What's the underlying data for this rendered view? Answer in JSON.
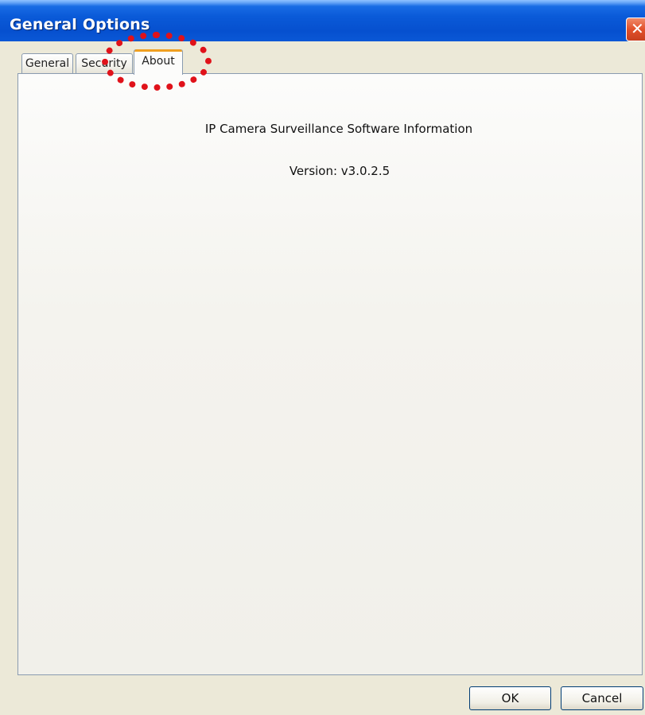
{
  "window": {
    "title": "General Options",
    "close_icon": "close-icon",
    "close_glyph": "✕"
  },
  "tabs": [
    {
      "label": "General",
      "selected": false
    },
    {
      "label": "Security",
      "selected": false
    },
    {
      "label": "About",
      "selected": true
    }
  ],
  "about": {
    "heading": "IP Camera Surveillance Software Information",
    "version": "Version: v3.0.2.5"
  },
  "buttons": {
    "ok": "OK",
    "cancel": "Cancel"
  },
  "annotation": {
    "highlight_color": "#e0121a",
    "highlight_target": "About"
  },
  "colors": {
    "titlebar": "#0a5ad8",
    "close_button": "#e2502a",
    "selected_tab_accent": "#f0a020"
  }
}
